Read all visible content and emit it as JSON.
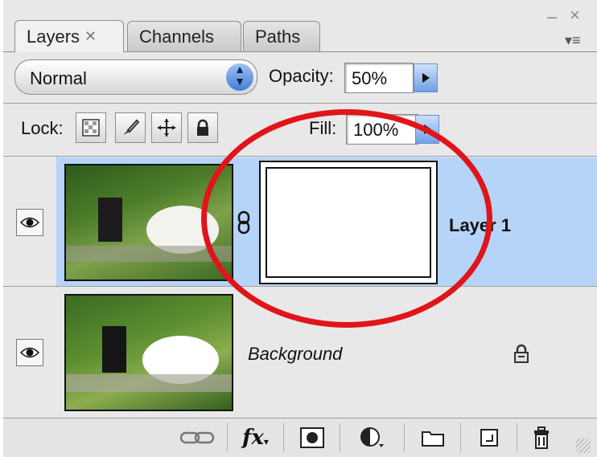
{
  "panel": {
    "tabs": [
      {
        "label": "Layers",
        "active": true
      },
      {
        "label": "Channels",
        "active": false
      },
      {
        "label": "Paths",
        "active": false
      }
    ],
    "tab_close_glyph": "✕",
    "window_controls": {
      "minimize": "–",
      "close": "×",
      "menu": "▾≡"
    }
  },
  "toolbar": {
    "blend_mode": "Normal",
    "opacity_label": "Opacity:",
    "opacity_value": "50%",
    "lock_label": "Lock:",
    "fill_label": "Fill:",
    "fill_value": "100%"
  },
  "lock_icons": [
    "lock-transparent-pixels-icon",
    "lock-image-pixels-icon",
    "lock-position-icon",
    "lock-all-icon"
  ],
  "layers": [
    {
      "name": "Layer 1",
      "selected": true,
      "visible": true,
      "has_mask": true,
      "linked": true
    },
    {
      "name": "Background",
      "selected": false,
      "visible": true,
      "locked": true
    }
  ],
  "bottom_icons": [
    "link-layers-icon",
    "fx-icon",
    "add-mask-icon",
    "adjustment-layer-icon",
    "new-group-icon",
    "new-layer-icon",
    "delete-layer-icon"
  ],
  "fx_label": "fx",
  "colors": {
    "selection": "#b5d4f8",
    "annotation": "#e0141a",
    "accent_button": "#6ea0e6"
  }
}
